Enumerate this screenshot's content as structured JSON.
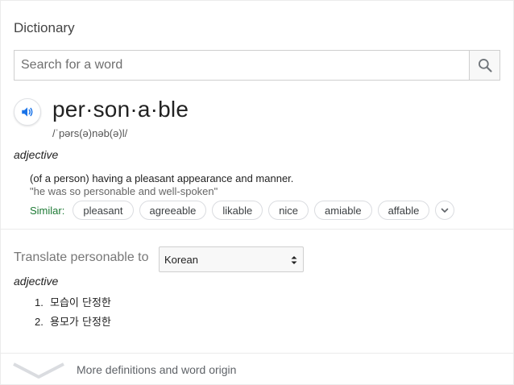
{
  "title": "Dictionary",
  "search": {
    "placeholder": "Search for a word",
    "value": ""
  },
  "entry": {
    "headword": "per·son·a·ble",
    "phonetic": "/ˈpərs(ə)nəb(ə)l/",
    "part_of_speech": "adjective",
    "definition": "(of a person) having a pleasant appearance and manner.",
    "example": "\"he was so personable and well-spoken\"",
    "similar_label": "Similar:",
    "similar": [
      "pleasant",
      "agreeable",
      "likable",
      "nice",
      "amiable",
      "affable"
    ]
  },
  "translate": {
    "label": "Translate personable to",
    "selected_language": "Korean",
    "part_of_speech": "adjective",
    "items": [
      {
        "num": "1.",
        "text": "모습이 단정한"
      },
      {
        "num": "2.",
        "text": "용모가 단정한"
      }
    ]
  },
  "footer": {
    "more_label": "More definitions and word origin"
  },
  "icons": {
    "search": "search-icon",
    "speaker": "speaker-icon",
    "expand": "chevron-down-icon",
    "select_arrows": "select-arrows-icon",
    "more": "chevron-down-icon"
  },
  "colors": {
    "accent_blue": "#1a73e8",
    "similar_green": "#1e7a35"
  }
}
